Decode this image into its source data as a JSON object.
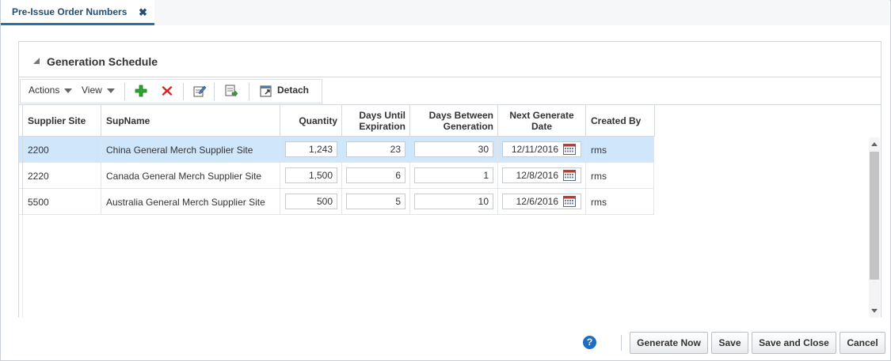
{
  "tab": {
    "title": "Pre-Issue Order Numbers",
    "close_glyph": "✖"
  },
  "panel": {
    "title": "Generation Schedule"
  },
  "toolbar": {
    "actions_label": "Actions",
    "view_label": "View",
    "detach_label": "Detach",
    "icons": [
      "add-icon",
      "delete-icon",
      "edit-icon",
      "export-icon",
      "detach-icon"
    ]
  },
  "table": {
    "columns": [
      "Supplier Site",
      "SupName",
      "Quantity",
      "Days Until Expiration",
      "Days Between Generation",
      "Next Generate Date",
      "Created By"
    ],
    "rows": [
      {
        "site": "2200",
        "name": "China General Merch Supplier Site",
        "quantity": "1,243",
        "days_until": "23",
        "days_between": "30",
        "next_date": "12/11/2016",
        "created_by": "rms",
        "selected": true
      },
      {
        "site": "2220",
        "name": "Canada General Merch Supplier Site",
        "quantity": "1,500",
        "days_until": "6",
        "days_between": "1",
        "next_date": "12/8/2016",
        "created_by": "rms",
        "selected": false
      },
      {
        "site": "5500",
        "name": "Australia General Merch Supplier Site",
        "quantity": "500",
        "days_until": "5",
        "days_between": "10",
        "next_date": "12/6/2016",
        "created_by": "rms",
        "selected": false
      }
    ]
  },
  "footer": {
    "help_glyph": "?",
    "generate_now": "Generate Now",
    "save": "Save",
    "save_close": "Save and Close",
    "cancel": "Cancel"
  },
  "colors": {
    "accent": "#2f6fa7",
    "selected_row": "#cfe6fb",
    "add_icon": "#2ea32e",
    "delete_icon": "#d9221c",
    "help_icon": "#1e6fc4"
  }
}
